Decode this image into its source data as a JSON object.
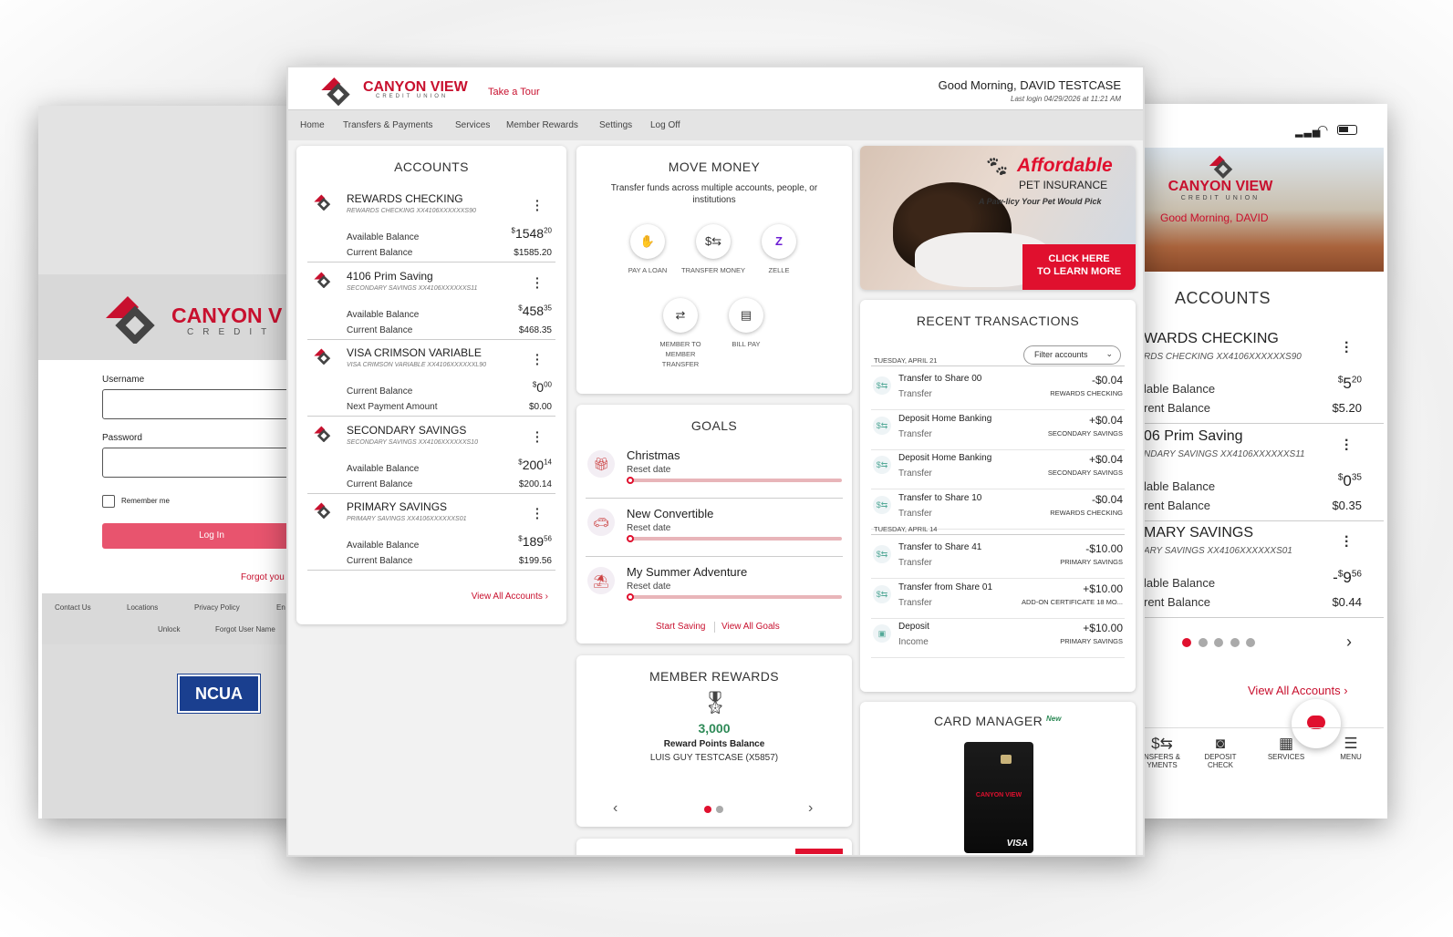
{
  "login": {
    "brand": "CANYON V",
    "brand_sub": "CREDIT UN",
    "username_label": "Username",
    "password_label": "Password",
    "remember_label": "Remember me",
    "login_button": "Log In",
    "forgot_link": "Forgot you",
    "footer_links": [
      "Contact Us",
      "Locations",
      "Privacy Policy",
      "En"
    ],
    "footer_links2": [
      "Unlock",
      "Forgot User Name"
    ],
    "ncua": "NCUA"
  },
  "header": {
    "brand": "CANYON VIEW",
    "brand_sub": "CREDIT UNION",
    "tour": "Take a Tour",
    "greeting": "Good Morning, DAVID TESTCASE",
    "last_login": "Last login 04/29/2026 at 11:21 AM"
  },
  "nav": [
    "Home",
    "Transfers & Payments",
    "Services",
    "Member Rewards",
    "Settings",
    "Log Off"
  ],
  "accounts": {
    "title": "ACCOUNTS",
    "items": [
      {
        "name": "REWARDS CHECKING",
        "sub": "REWARDS CHECKING XX4106XXXXXXS90",
        "l1": "Available Balance",
        "v1_main": "1548",
        "v1_cents": "20",
        "l2": "Current Balance",
        "v2": "$1585.20"
      },
      {
        "name": "4106 Prim Saving",
        "sub": "SECONDARY SAVINGS XX4106XXXXXXS11",
        "l1": "Available Balance",
        "v1_main": "458",
        "v1_cents": "35",
        "l2": "Current Balance",
        "v2": "$468.35"
      },
      {
        "name": "VISA CRIMSON VARIABLE",
        "sub": "VISA CRIMSON VARIABLE XX4106XXXXXXL90",
        "l1": "Current Balance",
        "v1_main": "0",
        "v1_cents": "00",
        "l2": "Next Payment Amount",
        "v2": "$0.00"
      },
      {
        "name": "SECONDARY SAVINGS",
        "sub": "SECONDARY SAVINGS XX4106XXXXXXS10",
        "l1": "Available Balance",
        "v1_main": "200",
        "v1_cents": "14",
        "l2": "Current Balance",
        "v2": "$200.14"
      },
      {
        "name": "PRIMARY SAVINGS",
        "sub": "PRIMARY SAVINGS XX4106XXXXXXS01",
        "l1": "Available Balance",
        "v1_main": "189",
        "v1_cents": "56",
        "l2": "Current Balance",
        "v2": "$199.56"
      }
    ],
    "view_all": "View All Accounts"
  },
  "move_money": {
    "title": "MOVE MONEY",
    "desc": "Transfer funds across multiple accounts, people, or institutions",
    "actions": [
      "PAY A LOAN",
      "TRANSFER MONEY",
      "ZELLE",
      "MEMBER TO MEMBER TRANSFER",
      "BILL PAY"
    ]
  },
  "goals": {
    "title": "GOALS",
    "items": [
      {
        "name": "Christmas",
        "sub": "Reset date",
        "progress": 0.03
      },
      {
        "name": "New Convertible",
        "sub": "Reset date",
        "progress": 0
      },
      {
        "name": "My Summer Adventure",
        "sub": "Reset date",
        "progress": 0
      }
    ],
    "start": "Start Saving",
    "view_all": "View All Goals"
  },
  "rewards": {
    "title": "MEMBER REWARDS",
    "points": "3,000",
    "points_label": "Reward Points Balance",
    "member": "LUIS GUY TESTCASE (X5857)"
  },
  "promo": {
    "title": "Affordable",
    "subtitle": "PET INSURANCE",
    "tagline": "A Paw-licy Your Pet Would Pick",
    "cta1": "CLICK HERE",
    "cta2": "TO LEARN MORE"
  },
  "transactions": {
    "title": "RECENT TRANSACTIONS",
    "filter": "Filter accounts",
    "groups": [
      {
        "date": "TUESDAY, APRIL 21",
        "items": [
          {
            "desc": "Transfer to Share 00",
            "type": "Transfer",
            "amount": "-$0.04",
            "account": "REWARDS CHECKING"
          },
          {
            "desc": "Deposit Home Banking",
            "type": "Transfer",
            "amount": "+$0.04",
            "account": "SECONDARY SAVINGS"
          },
          {
            "desc": "Deposit Home Banking",
            "type": "Transfer",
            "amount": "+$0.04",
            "account": "SECONDARY SAVINGS"
          },
          {
            "desc": "Transfer to Share 10",
            "type": "Transfer",
            "amount": "-$0.04",
            "account": "REWARDS CHECKING"
          }
        ]
      },
      {
        "date": "TUESDAY, APRIL 14",
        "items": [
          {
            "desc": "Transfer to Share 41",
            "type": "Transfer",
            "amount": "-$10.00",
            "account": "PRIMARY SAVINGS"
          },
          {
            "desc": "Transfer from Share 01",
            "type": "Transfer",
            "amount": "+$10.00",
            "account": "ADD-ON CERTIFICATE 18 MO..."
          },
          {
            "desc": "Deposit",
            "type": "Income",
            "amount": "+$10.00",
            "account": "PRIMARY SAVINGS"
          }
        ]
      }
    ]
  },
  "card_manager": {
    "title": "CARD MANAGER",
    "badge": "New",
    "card_brand": "CANYON VIEW",
    "network": "VISA"
  },
  "mobile": {
    "brand": "CANYON VIEW",
    "brand_sub": "CREDIT UNION",
    "greeting": "Good Morning, DAVID",
    "accounts_title": "ACCOUNTS",
    "accounts": [
      {
        "name": "WARDS CHECKING",
        "sub": "RDS CHECKING XX4106XXXXXXS90",
        "l1": "lable Balance",
        "v1_main": "5",
        "v1_cents": "20",
        "l2": "rent Balance",
        "v2": "$5.20",
        "neg": ""
      },
      {
        "name": "06 Prim Saving",
        "sub": "NDARY SAVINGS XX4106XXXXXXS11",
        "l1": "lable Balance",
        "v1_main": "0",
        "v1_cents": "35",
        "l2": "rent Balance",
        "v2": "$0.35",
        "neg": ""
      },
      {
        "name": "MARY SAVINGS",
        "sub": "ARY SAVINGS XX4106XXXXXXS01",
        "l1": "lable Balance",
        "v1_main": "9",
        "v1_cents": "56",
        "l2": "rent Balance",
        "v2": "$0.44",
        "neg": "-"
      }
    ],
    "view_all": "View All Accounts",
    "tabs": [
      "NSFERS & YMENTS",
      "DEPOSIT CHECK",
      "SERVICES",
      "MENU"
    ]
  },
  "colors": {
    "brand_red": "#c8102e",
    "login_button": "#e8546e"
  }
}
